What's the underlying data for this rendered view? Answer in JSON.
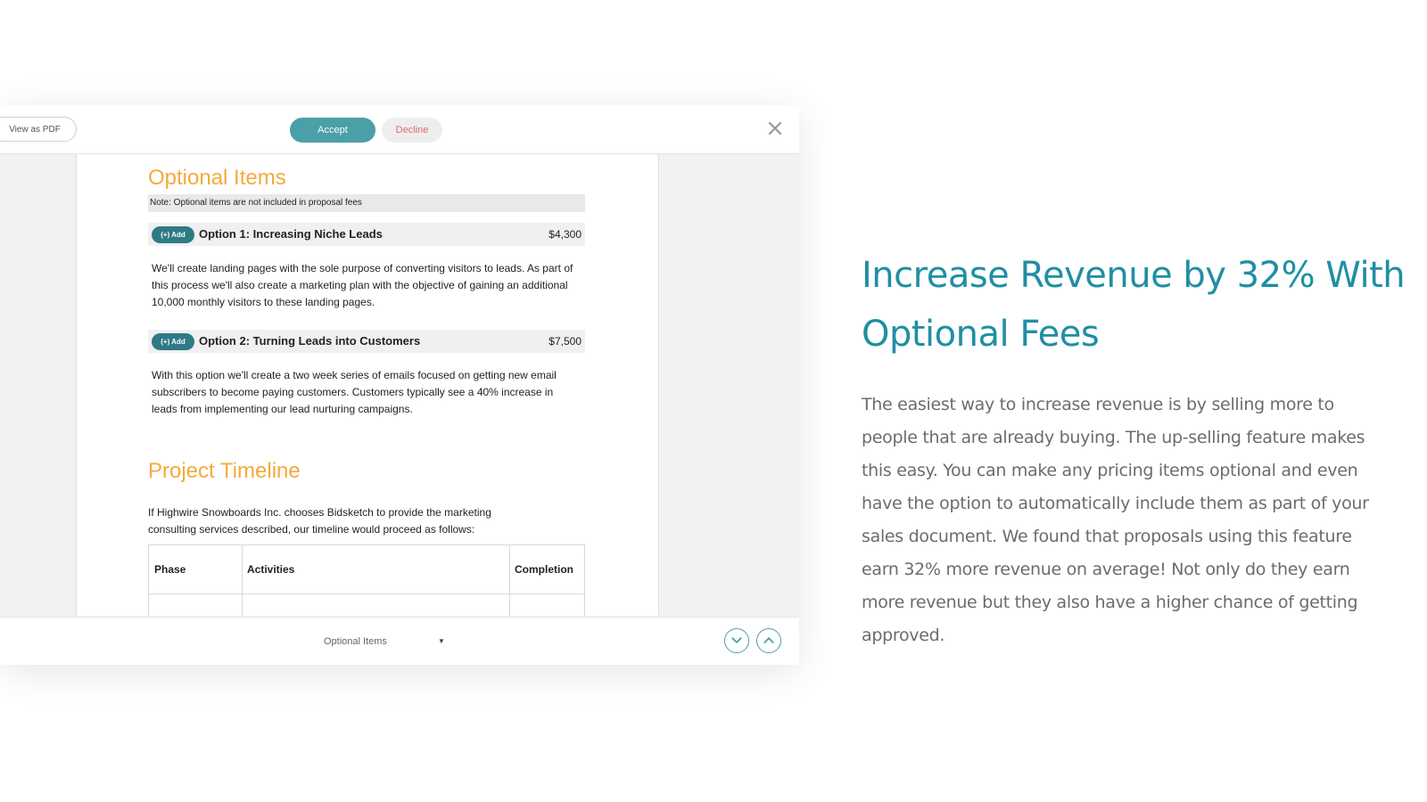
{
  "toolbar": {
    "view_pdf_label": "View as PDF",
    "accept_label": "Accept",
    "decline_label": "Decline",
    "close_icon": "close-icon"
  },
  "document": {
    "optional_heading": "Optional Items",
    "note": "Note: Optional items are not included in proposal fees",
    "options": [
      {
        "add_label": "(+) Add",
        "title": "Option 1: Increasing Niche Leads",
        "price": "$4,300",
        "description": "We'll create landing pages with the sole purpose of converting visitors to leads. As part of this process we'll also create a marketing plan with the objective of gaining an additional 10,000 monthly visitors to these landing pages."
      },
      {
        "add_label": "(+) Add",
        "title": "Option 2: Turning Leads into Customers",
        "price": "$7,500",
        "description": "With this option we'll create a two week series of emails focused on getting new email subscribers to become paying customers. Customers typically see a 40% increase in leads from implementing our lead nurturing campaigns."
      }
    ],
    "timeline_heading": "Project Timeline",
    "timeline_intro": "If Highwire Snowboards Inc. chooses Bidsketch to provide the marketing consulting services described, our timeline would proceed as follows:",
    "table_headers": [
      "Phase",
      "Activities",
      "Completion"
    ]
  },
  "bottom_bar": {
    "section_select": "Optional Items",
    "next_icon": "chevron-down-icon",
    "prev_icon": "chevron-up-icon"
  },
  "feature": {
    "headline": "Increase Revenue by 32% With Optional Fees",
    "body": "The easiest way to increase revenue is by selling more to people that are already buying. The up-selling feature makes this easy. You can make any pricing items optional and even have the option to automatically include them as part of your sales document. We found that proposals using this feature earn 32% more revenue on average! Not only do they earn more revenue but they also have a higher chance of getting approved."
  },
  "colors": {
    "accent": "#4b9fa6",
    "headline": "#1f8fa3",
    "heading_orange": "#f5a93c",
    "decline": "#e06a6a"
  }
}
